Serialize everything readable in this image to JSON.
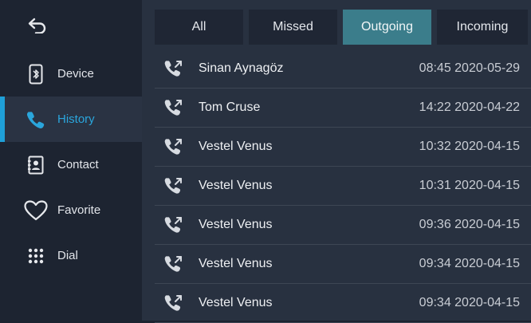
{
  "sidebar": {
    "back_icon": "back-arrow-icon",
    "items": [
      {
        "label": "Device",
        "icon": "bluetooth-phone-icon",
        "active": false
      },
      {
        "label": "History",
        "icon": "phone-handset-icon",
        "active": true
      },
      {
        "label": "Contact",
        "icon": "contact-book-icon",
        "active": false
      },
      {
        "label": "Favorite",
        "icon": "heart-icon",
        "active": false
      },
      {
        "label": "Dial",
        "icon": "dialpad-icon",
        "active": false
      }
    ]
  },
  "tabs": [
    {
      "label": "All",
      "active": false
    },
    {
      "label": "Missed",
      "active": false
    },
    {
      "label": "Outgoing",
      "active": true
    },
    {
      "label": "Incoming",
      "active": false
    }
  ],
  "calls": [
    {
      "name": "Sinan Aynagöz",
      "time": "08:45 2020-05-29",
      "icon": "outgoing-call-icon"
    },
    {
      "name": "Tom Cruse",
      "time": "14:22 2020-04-22",
      "icon": "outgoing-call-icon"
    },
    {
      "name": "Vestel Venus",
      "time": "10:32 2020-04-15",
      "icon": "outgoing-call-icon"
    },
    {
      "name": "Vestel Venus",
      "time": "10:31 2020-04-15",
      "icon": "outgoing-call-icon"
    },
    {
      "name": "Vestel Venus",
      "time": "09:36 2020-04-15",
      "icon": "outgoing-call-icon"
    },
    {
      "name": "Vestel Venus",
      "time": "09:34 2020-04-15",
      "icon": "outgoing-call-icon"
    },
    {
      "name": "Vestel Venus",
      "time": "09:34 2020-04-15",
      "icon": "outgoing-call-icon"
    }
  ],
  "colors": {
    "accent": "#1fa0d8",
    "active_tab": "#3b7d8b",
    "background": "#283140",
    "sidebar": "#1d2431"
  }
}
